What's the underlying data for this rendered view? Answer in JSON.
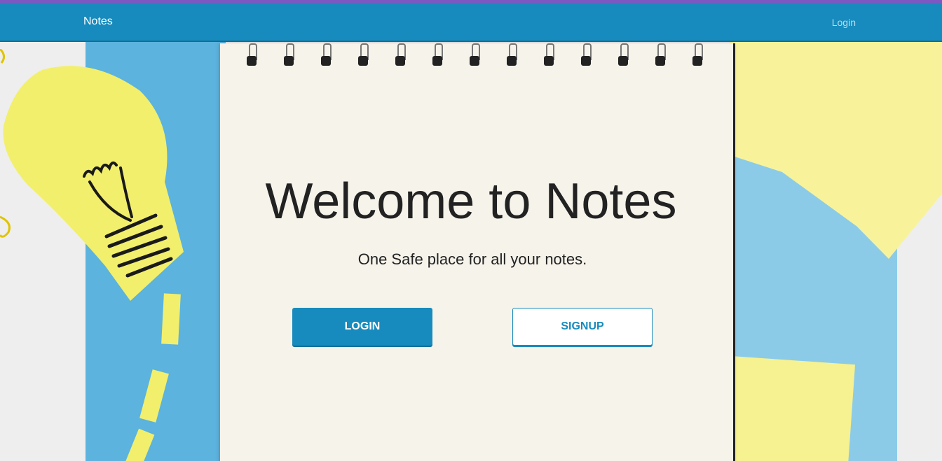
{
  "nav": {
    "brand": "Notes",
    "login_link": "Login"
  },
  "hero": {
    "title": "Welcome to Notes",
    "tagline": "One Safe place for all your notes.",
    "login_button": "LOGIN",
    "signup_button": "SIGNUP"
  },
  "colors": {
    "primary": "#178bbd",
    "accent_stripe": "#7e57c2",
    "notebook_paper": "#f6f3ea",
    "paper_blue": "#5bb3de",
    "paper_yellow": "#f8f39a"
  },
  "icons": {
    "decor": "lightbulb-drawing"
  }
}
